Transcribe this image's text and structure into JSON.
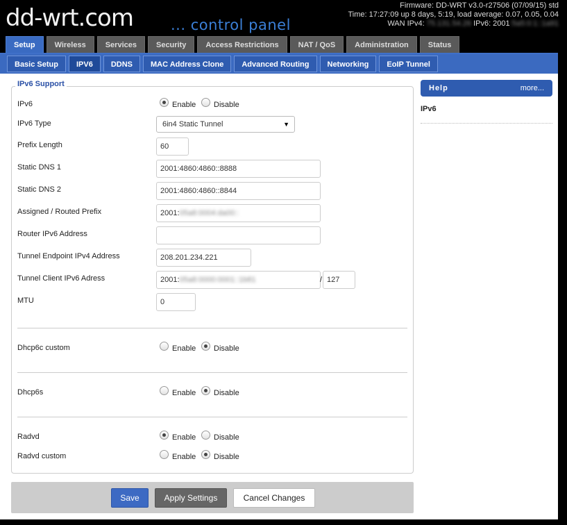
{
  "header": {
    "logo": "dd-wrt.com",
    "tagline": "... control panel",
    "firmware": "Firmware: DD-WRT v3.0-r27506 (07/09/15) std",
    "time": "Time: 17:27:09 up 8 days, 5:19, load average: 0.07, 0.05, 0.04",
    "wan_prefix": "WAN IPv4:",
    "wan_ipv4_blurred": "75.131.54.26",
    "wan_ipv6_prefix": "IPv6: 2001",
    "wan_ipv6_blurred": ":5a5:0:1::1a91"
  },
  "main_tabs": [
    "Setup",
    "Wireless",
    "Services",
    "Security",
    "Access Restrictions",
    "NAT / QoS",
    "Administration",
    "Status"
  ],
  "sub_tabs": [
    "Basic Setup",
    "IPV6",
    "DDNS",
    "MAC Address Clone",
    "Advanced Routing",
    "Networking",
    "EoIP Tunnel"
  ],
  "section": {
    "legend": "IPv6 Support",
    "ipv6": {
      "label": "IPv6",
      "enable": "Enable",
      "disable": "Disable",
      "value": "Enable"
    },
    "ipv6_type": {
      "label": "IPv6 Type",
      "value": "6in4 Static Tunnel"
    },
    "prefix_length": {
      "label": "Prefix Length",
      "value": "60"
    },
    "static_dns1": {
      "label": "Static DNS 1",
      "value": "2001:4860:4860::8888"
    },
    "static_dns2": {
      "label": "Static DNS 2",
      "value": "2001:4860:4860::8844"
    },
    "assigned_prefix": {
      "label": "Assigned / Routed Prefix",
      "value_prefix": "2001:",
      "value_blurred": "05a8:0004:da00::"
    },
    "router_address": {
      "label": "Router IPv6 Address",
      "value": ""
    },
    "tunnel_endpoint": {
      "label": "Tunnel Endpoint IPv4 Address",
      "value": "208.201.234.221"
    },
    "tunnel_client": {
      "label": "Tunnel Client IPv6 Adress",
      "value_prefix": "2001:",
      "value_blurred": "05a8:0000:0001::1b81",
      "separator": "/",
      "mask": "127"
    },
    "mtu": {
      "label": "MTU",
      "value": "0"
    },
    "dhcp6c_custom": {
      "label": "Dhcp6c custom",
      "enable": "Enable",
      "disable": "Disable",
      "value": "Disable"
    },
    "dhcp6s": {
      "label": "Dhcp6s",
      "enable": "Enable",
      "disable": "Disable",
      "value": "Disable"
    },
    "radvd": {
      "label": "Radvd",
      "enable": "Enable",
      "disable": "Disable",
      "value": "Enable"
    },
    "radvd_custom": {
      "label": "Radvd custom",
      "enable": "Enable",
      "disable": "Disable",
      "value": "Disable"
    }
  },
  "help": {
    "title": "Help",
    "more": "more...",
    "item": "IPv6"
  },
  "buttons": {
    "save": "Save",
    "apply": "Apply Settings",
    "cancel": "Cancel Changes"
  },
  "colors": {
    "accent": "#3b6ac0",
    "legend": "#2a50a6",
    "tagline": "#3b7fd6"
  }
}
